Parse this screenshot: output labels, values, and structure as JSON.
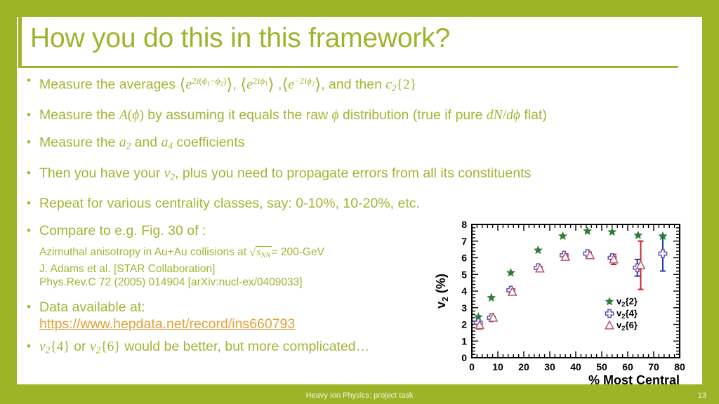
{
  "theme": {
    "border_color": "#9DB428",
    "canvas_color": "#FFFFFF",
    "text_color": "#A2B534",
    "title_color": "#9DB42B",
    "link_color": "#E2A13A",
    "footer_text_color": "#F2F5E4"
  },
  "title": "How you do this in this framework?",
  "bullets": {
    "b1_prefix": "Measure the averages ",
    "b1_suffix": ", and then ",
    "b2_a": "Measure the ",
    "b2_b": " by assuming it equals the raw ",
    "b2_c": " distribution (true if pure ",
    "b2_d": " flat)",
    "b3_a": "Measure the ",
    "b3_b": " and ",
    "b3_c": " coefficients",
    "b4_a": "Then you have your ",
    "b4_b": ", plus you need to propagate errors from all its constituents",
    "b5": "Repeat for various centrality classes, say: 0-10%, 10-20%, etc.",
    "b6": "Compare to e.g. Fig. 30 of :",
    "b7": "Data available at:",
    "b8_a": " or ",
    "b8_b": " would be better, but more complicated…"
  },
  "citation": {
    "line1_pre": "Azimuthal anisotropy in Au+Au collisions at ",
    "line1_post": "= 200-GeV",
    "line2": "J. Adams et al. [STAR Collaboration]",
    "line3": "Phys.Rev.C 72 (2005) 014904 [arXiv:nucl-ex/0409033]"
  },
  "link": {
    "label": "https://www.hepdata.net/record/ins660793"
  },
  "footer": {
    "title": "Heavy Ion Physics: project task",
    "page_number": "13"
  },
  "chart_data": {
    "type": "scatter",
    "title": "",
    "xlabel": "% Most Central",
    "ylabel": "v_2 (%)",
    "ylabel_base": "v",
    "ylabel_sub": "2",
    "ylabel_unit": " (%)",
    "xlim": [
      0,
      80
    ],
    "ylim": [
      0,
      8
    ],
    "xticks": [
      0,
      10,
      20,
      30,
      40,
      50,
      60,
      70,
      80
    ],
    "yticks": [
      0,
      1,
      2,
      3,
      4,
      5,
      6,
      7,
      8
    ],
    "grid": false,
    "legend_position": "lower-right",
    "series": [
      {
        "name": "v_2{2}",
        "legend_base": "v",
        "legend_sub": "2",
        "legend_braces": "{2}",
        "marker": "star",
        "color": "#2E7D32",
        "x": [
          2.5,
          7.5,
          15.0,
          25.5,
          35.0,
          44.5,
          54.0,
          64.0,
          73.5
        ],
        "y": [
          2.45,
          3.6,
          5.1,
          6.45,
          7.3,
          7.6,
          7.55,
          7.35,
          7.3
        ],
        "yerr": [
          0,
          0,
          0,
          0,
          0,
          0,
          0,
          0,
          0
        ]
      },
      {
        "name": "v_2{4}",
        "legend_base": "v",
        "legend_sub": "2",
        "legend_braces": "{4}",
        "marker": "cross",
        "color": "#5B4FB5",
        "x": [
          2.5,
          7.5,
          15.0,
          25.5,
          35.5,
          44.5,
          54.0,
          63.7,
          73.5
        ],
        "y": [
          2.1,
          2.4,
          4.05,
          5.4,
          6.15,
          6.25,
          6.0,
          5.4,
          6.25
        ],
        "yerr": [
          0,
          0,
          0,
          0,
          0,
          0,
          0,
          0.5,
          1.05
        ],
        "errcolor": "#1F3FAF"
      },
      {
        "name": "v_2{6}",
        "legend_base": "v",
        "legend_sub": "2",
        "legend_braces": "{6}",
        "marker": "triangle",
        "color": "#C0506A",
        "x": [
          3.0,
          8.2,
          15.6,
          26.2,
          36.0,
          45.5,
          54.6,
          65.0
        ],
        "y": [
          1.95,
          2.4,
          3.95,
          5.35,
          6.05,
          6.15,
          5.9,
          5.55
        ],
        "yerr": [
          0.22,
          0,
          0,
          0,
          0,
          0,
          0.3,
          1.45
        ],
        "errcolor": "#CC2222"
      }
    ]
  }
}
